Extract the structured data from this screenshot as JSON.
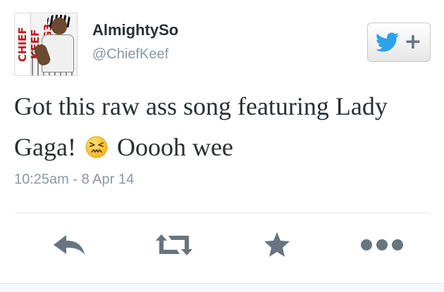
{
  "tweet": {
    "display_name": "AlmightySo",
    "handle": "@ChiefKeef",
    "text_before_emoji": "Got this raw ass song featuring Lady Gaga!",
    "emoji": "confounded-face-emoji",
    "text_after_emoji": "Ooooh wee",
    "timestamp": "10:25am - 8 Apr 14"
  },
  "avatar": {
    "cover_text": "CHIEF KEEF BANG3"
  },
  "follow_button": {
    "icon": "twitter-bird-icon",
    "symbol": "+"
  },
  "actions": [
    {
      "name": "reply",
      "icon": "reply-arrow-icon"
    },
    {
      "name": "retweet",
      "icon": "retweet-icon"
    },
    {
      "name": "favorite",
      "icon": "star-icon"
    },
    {
      "name": "more",
      "icon": "ellipsis-icon"
    }
  ],
  "colors": {
    "text": "#292f33",
    "secondary": "#8899a6",
    "icon": "#66757f",
    "twitter_blue": "#2aa3ef",
    "divider": "#e1e8ed"
  }
}
